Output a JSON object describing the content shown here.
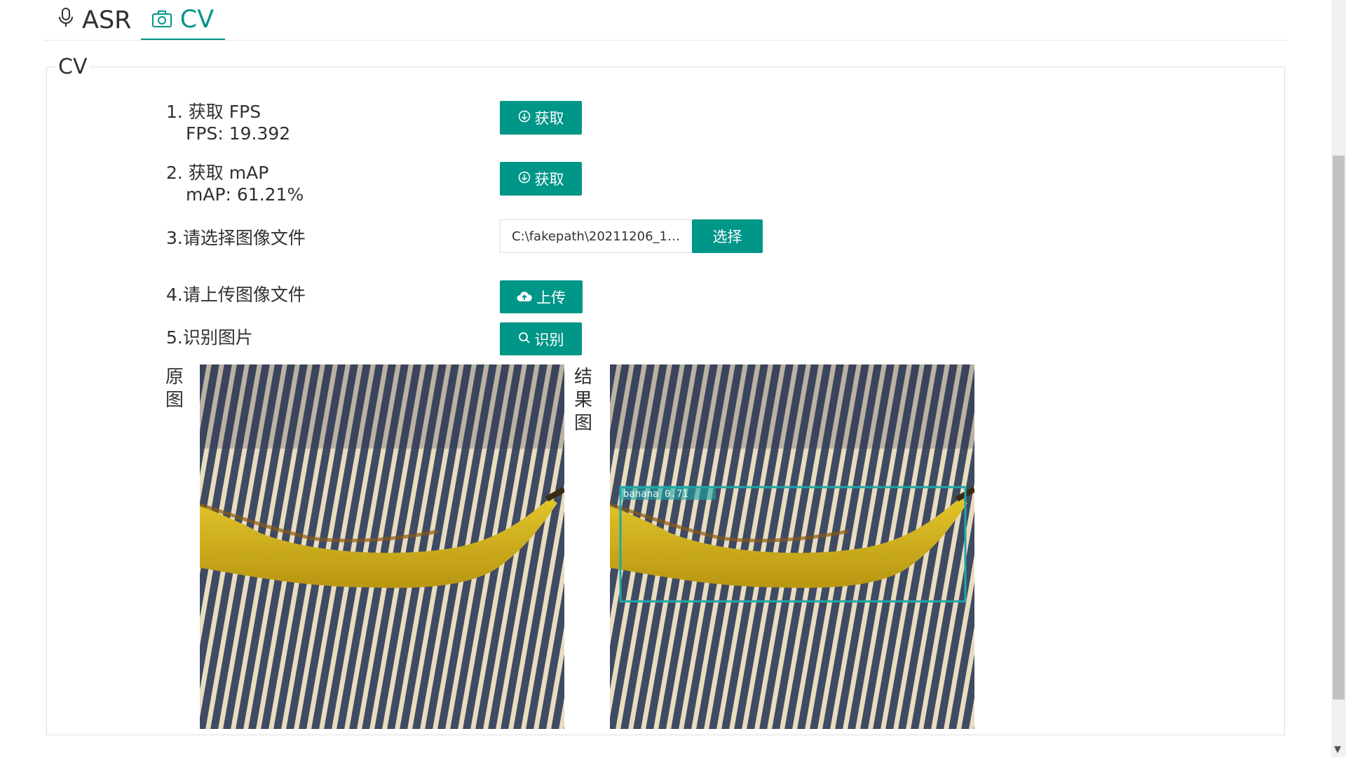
{
  "tabs": [
    {
      "label": "ASR",
      "icon": "microphone-icon"
    },
    {
      "label": "CV",
      "icon": "camera-icon"
    }
  ],
  "active_tab": "CV",
  "panel": {
    "legend": "CV"
  },
  "steps": {
    "fps": {
      "label": "1. 获取 FPS",
      "value": "FPS: 19.392",
      "button": "获取"
    },
    "map": {
      "label": "2. 获取 mAP",
      "value": "mAP: 61.21%",
      "button": "获取"
    },
    "select": {
      "label": "3.请选择图像文件",
      "file_value": "C:\\fakepath\\20211206_1651…",
      "button": "选择"
    },
    "upload": {
      "label": "4.请上传图像文件",
      "button": "上传"
    },
    "recognize": {
      "label": "5.识别图片",
      "button": "识别"
    }
  },
  "images": {
    "original_label": "原图",
    "result_label": "结果图",
    "detection_label": "banana 0.71"
  },
  "colors": {
    "accent": "#009688",
    "detection_box": "#1ca9a9"
  }
}
